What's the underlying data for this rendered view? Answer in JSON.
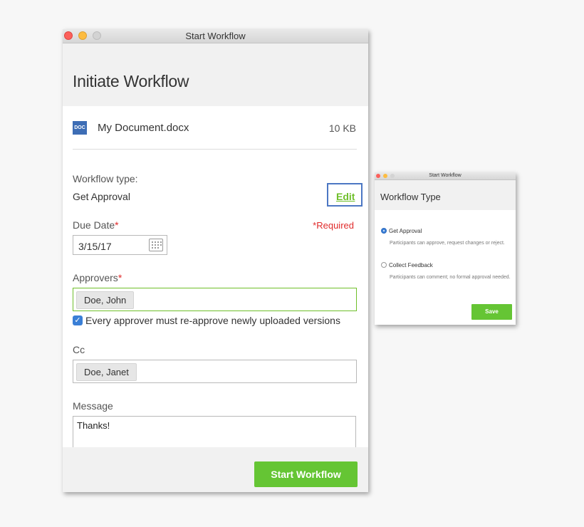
{
  "main_window": {
    "title": "Start Workflow",
    "heading": "Initiate Workflow",
    "document": {
      "icon": "doc-file-icon",
      "icon_label": "DOC",
      "name": "My Document.docx",
      "size": "10 KB"
    },
    "workflow_type": {
      "label": "Workflow type:",
      "value": "Get Approval",
      "edit_label": "Edit"
    },
    "due_date": {
      "label": "Due Date",
      "required_marker": "*",
      "value": "3/15/17",
      "required_note": "*Required",
      "icon": "calendar-icon"
    },
    "approvers": {
      "label": "Approvers",
      "required_marker": "*",
      "chips": [
        "Doe, John"
      ],
      "reapprove_checked": true,
      "reapprove_label": "Every approver must re-approve newly uploaded versions"
    },
    "cc": {
      "label": "Cc",
      "chips": [
        "Doe, Janet"
      ]
    },
    "message": {
      "label": "Message",
      "value": "Thanks!"
    },
    "primary_button": "Start Workflow"
  },
  "workflow_type_window": {
    "title": "Start Workflow",
    "heading": "Workflow Type",
    "options": [
      {
        "label": "Get Approval",
        "selected": true,
        "description": "Participants can approve, request changes or reject."
      },
      {
        "label": "Collect Feedback",
        "selected": false,
        "description": "Participants can comment; no formal approval needed."
      }
    ],
    "save_button": "Save"
  },
  "colors": {
    "accent_green": "#65c534",
    "link_green": "#6fbf2a",
    "highlight_blue": "#4c77c3",
    "required_red": "#e02b2b",
    "doc_icon_blue": "#3d6db5"
  }
}
